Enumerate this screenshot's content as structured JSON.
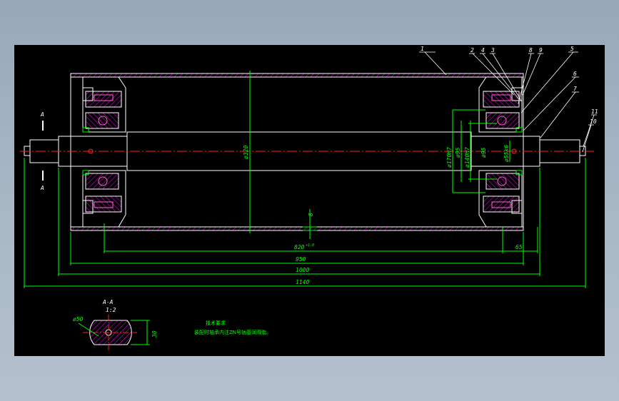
{
  "colors": {
    "background": "#9fb0c0",
    "sheet": "#000000",
    "outline": "#ffffff",
    "dimension": "#00ff00",
    "centerline": "#ff2020",
    "hatch": "#ff00ff",
    "bolt": "#ff66cc",
    "leader": "#ffffff"
  },
  "section_marks": {
    "top": "A",
    "bottom": "A"
  },
  "part_numbers": [
    "1",
    "2",
    "4",
    "3",
    "8",
    "9",
    "5",
    "6",
    "7",
    "11",
    "10"
  ],
  "dimensions": {
    "shell_diameter": "ø320",
    "bore_fit_1": "ø170H7",
    "bore_fit_2": "ø140H7",
    "bore_d1": "ø95",
    "bore_d2": "ø95",
    "shaft_fit": "ø55k6",
    "wall": "8",
    "length_820": "820",
    "length_820_tol": "+1.0",
    "offset_65": "65",
    "length_950": "950",
    "length_1000": "1000",
    "length_1140": "1140"
  },
  "section_view": {
    "title": "A-A",
    "scale": "1:2",
    "diameter": "ø50",
    "width": "30"
  },
  "notes": {
    "title": "技术要求",
    "line1": "装配时轴承内注ZN号钠基润滑脂。"
  }
}
